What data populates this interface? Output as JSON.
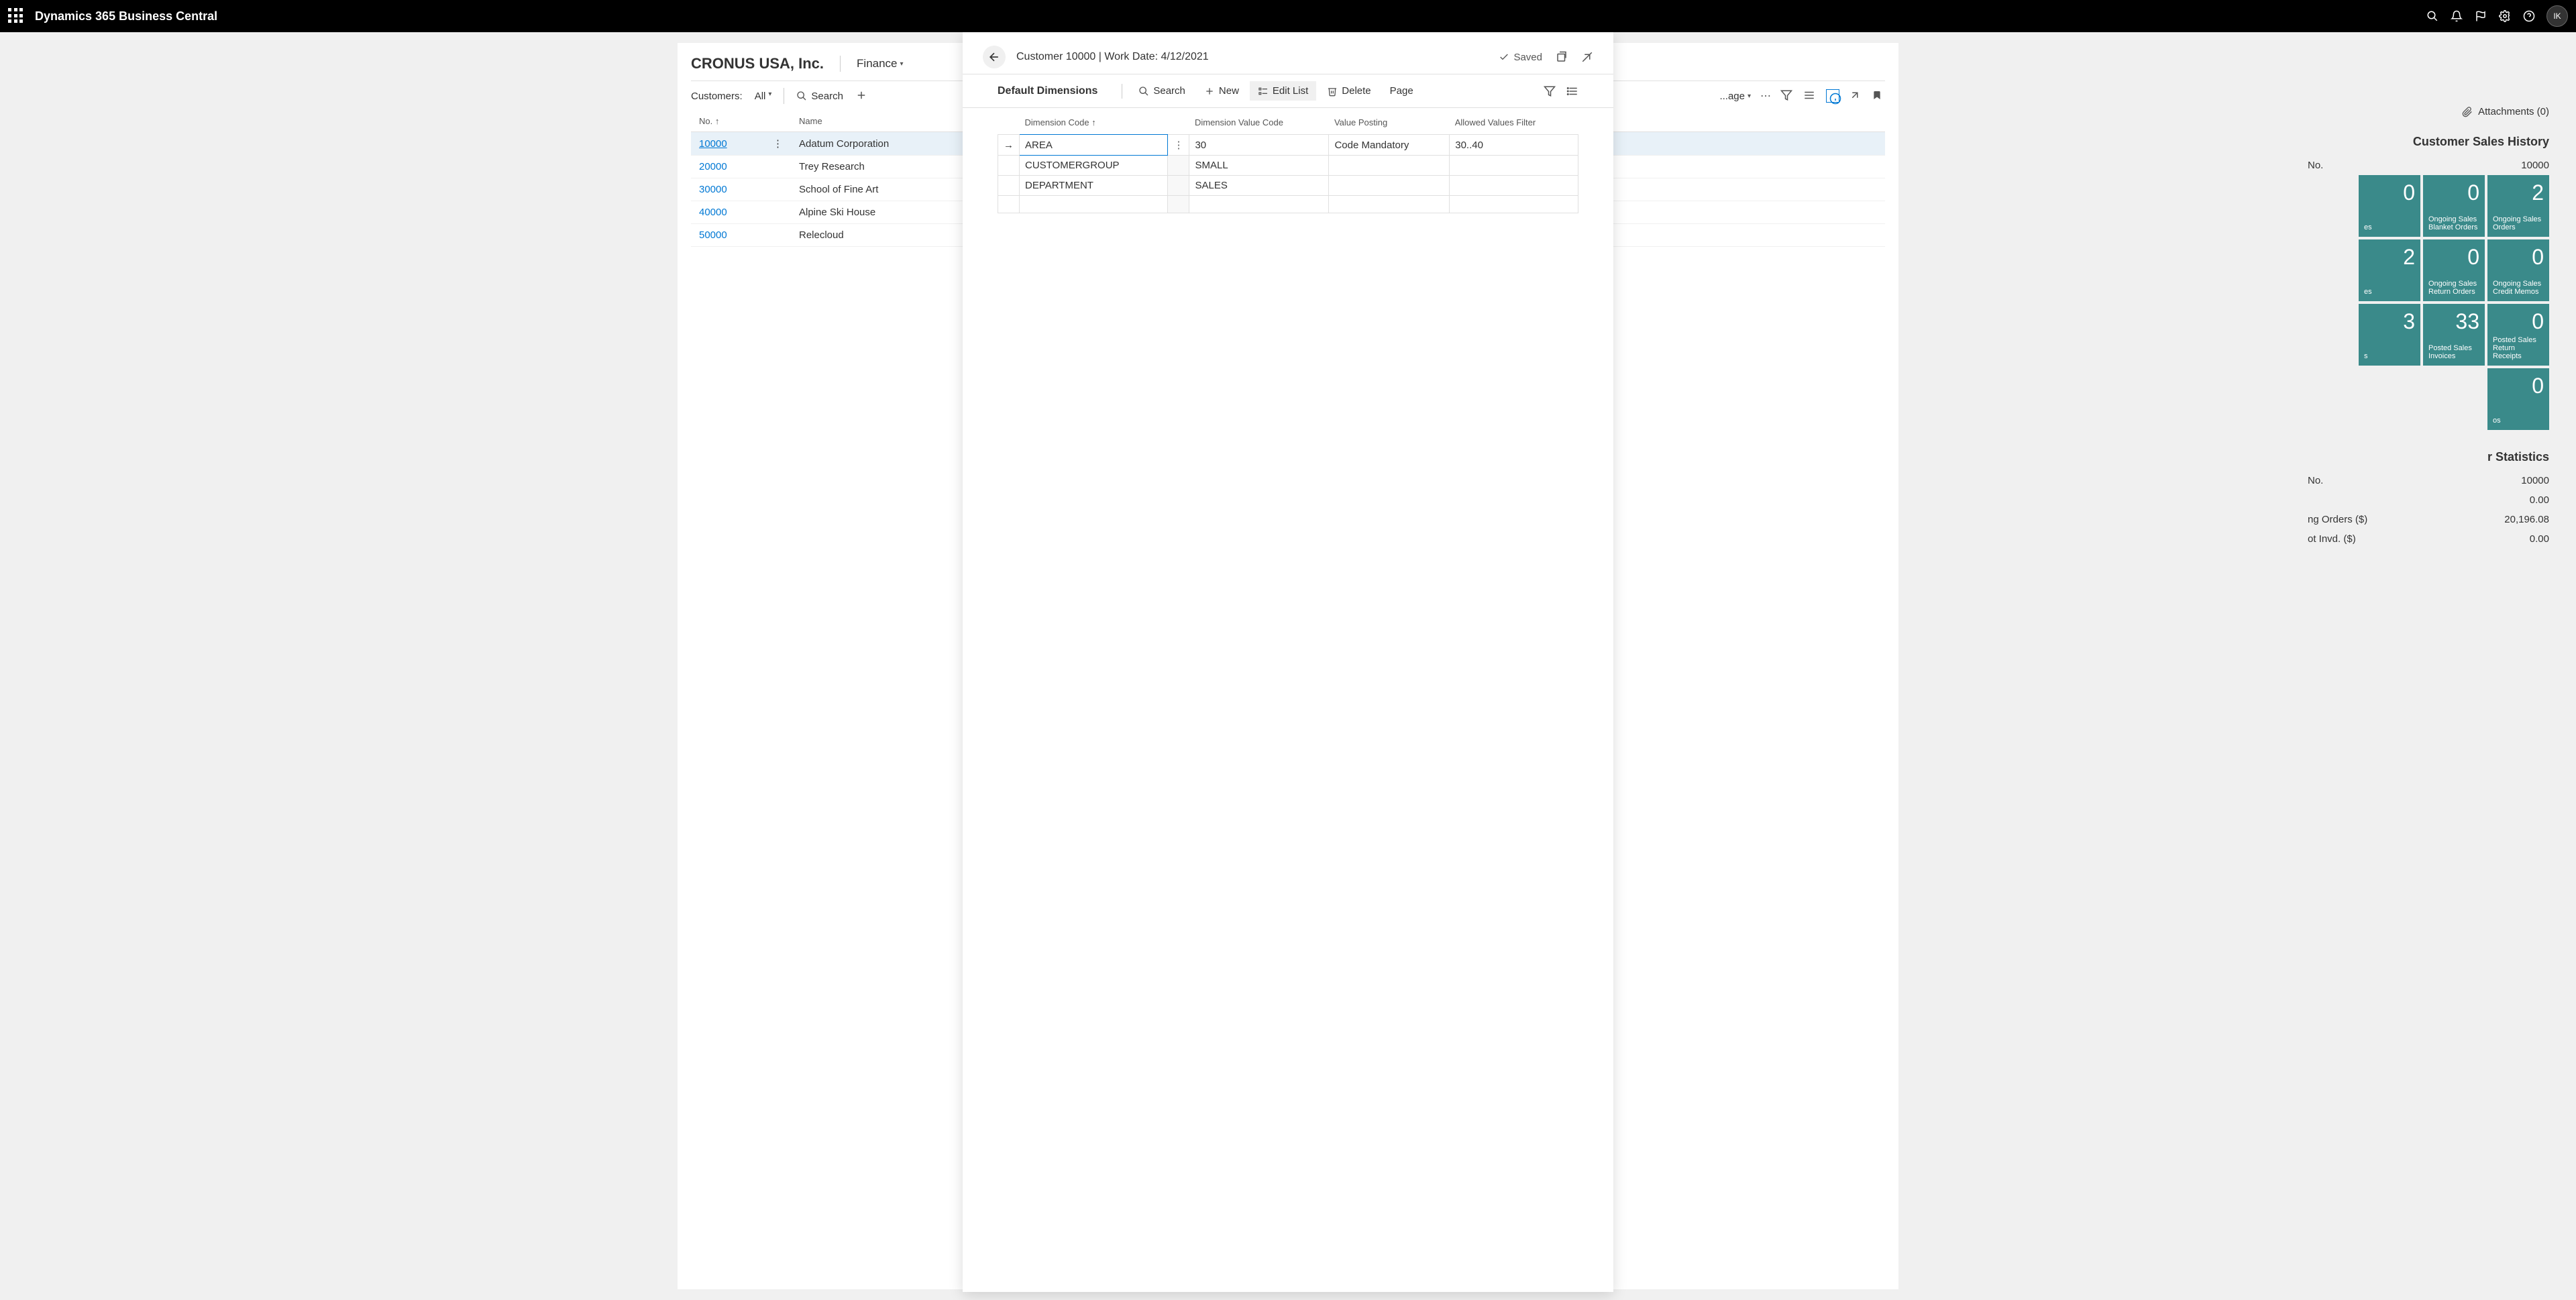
{
  "app_title": "Dynamics 365 Business Central",
  "user_initials": "IK",
  "page": {
    "company": "CRONUS USA, Inc.",
    "nav_item": "Finance",
    "list_label": "Customers:",
    "filter_all": "All",
    "search_label": "Search",
    "more_label": "...age"
  },
  "columns": {
    "no": "No.",
    "name": "Name"
  },
  "customers": [
    {
      "no": "10000",
      "name": "Adatum Corporation",
      "selected": true
    },
    {
      "no": "20000",
      "name": "Trey Research"
    },
    {
      "no": "30000",
      "name": "School of Fine Art"
    },
    {
      "no": "40000",
      "name": "Alpine Ski House"
    },
    {
      "no": "50000",
      "name": "Relecloud"
    }
  ],
  "right_panel": {
    "attachments": "Attachments (0)",
    "history_title": "Customer Sales History",
    "cust_no_label": "No.",
    "cust_no_value": "10000",
    "stats_title": "r Statistics",
    "tiles": [
      {
        "value": "0",
        "label": "es"
      },
      {
        "value": "0",
        "label": "Ongoing Sales Blanket Orders"
      },
      {
        "value": "2",
        "label": "Ongoing Sales Orders"
      },
      {
        "value": "2",
        "label": "es"
      },
      {
        "value": "0",
        "label": "Ongoing Sales Return Orders"
      },
      {
        "value": "0",
        "label": "Ongoing Sales Credit Memos"
      },
      {
        "value": "3",
        "label": "s"
      },
      {
        "value": "33",
        "label": "Posted Sales Invoices"
      },
      {
        "value": "0",
        "label": "Posted Sales Return Receipts"
      },
      {
        "value": "0",
        "label": "os"
      }
    ],
    "stats": [
      {
        "label": "No.",
        "value": "10000"
      },
      {
        "label": "",
        "value": "0.00"
      },
      {
        "label": "ng Orders ($)",
        "value": "20,196.08"
      },
      {
        "label": "ot Invd. ($)",
        "value": "0.00"
      }
    ]
  },
  "dialog": {
    "title": "Customer 10000 | Work Date: 4/12/2021",
    "saved": "Saved",
    "section_title": "Default Dimensions",
    "toolbar": {
      "search": "Search",
      "new": "New",
      "edit_list": "Edit List",
      "delete": "Delete",
      "page": "Page"
    },
    "columns": {
      "dim_code": "Dimension Code",
      "dim_value": "Dimension Value Code",
      "value_posting": "Value Posting",
      "allowed": "Allowed Values Filter"
    },
    "rows": [
      {
        "code": "AREA",
        "value": "30",
        "posting": "Code Mandatory",
        "allowed": "30..40",
        "active": true
      },
      {
        "code": "CUSTOMERGROUP",
        "value": "SMALL",
        "posting": "",
        "allowed": ""
      },
      {
        "code": "DEPARTMENT",
        "value": "SALES",
        "posting": "",
        "allowed": ""
      },
      {
        "code": "",
        "value": "",
        "posting": "",
        "allowed": ""
      }
    ]
  }
}
